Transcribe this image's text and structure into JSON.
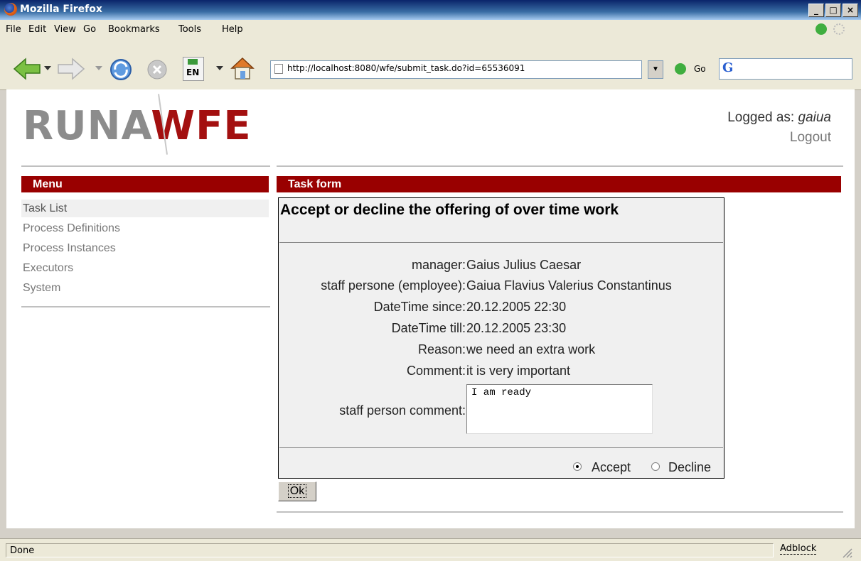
{
  "window": {
    "title": "Mozilla Firefox"
  },
  "menubar": [
    "File",
    "Edit",
    "View",
    "Go",
    "Bookmarks",
    "Tools",
    "Help"
  ],
  "toolbar": {
    "url": "http://localhost:8080/wfe/submit_task.do?id=65536091",
    "go_label": "Go",
    "lang_label": "EN"
  },
  "header": {
    "logo_left": "RUNA",
    "logo_right": "WFE",
    "logged_prefix": "Logged as: ",
    "user": "gaiua",
    "logout": "Logout"
  },
  "menu": {
    "title": "Menu",
    "items": [
      "Task List",
      "Process Definitions",
      "Process Instances",
      "Executors",
      "System"
    ]
  },
  "task": {
    "section_title": "Task form",
    "form_title": "Accept or decline the offering of over time work",
    "fields": [
      {
        "label": "manager:",
        "value": "Gaius Julius Caesar"
      },
      {
        "label": "staff persone (employee):",
        "value": "Gaiua Flavius Valerius Constantinus"
      },
      {
        "label": "DateTime since:",
        "value": "20.12.2005 22:30"
      },
      {
        "label": "DateTime till:",
        "value": "20.12.2005 23:30"
      },
      {
        "label": "Reason:",
        "value": "we need an extra work"
      },
      {
        "label": "Comment:",
        "value": "it is very important"
      }
    ],
    "comment_label": "staff person comment:",
    "comment_value": "I am ready",
    "accept_label": "Accept",
    "decline_label": "Decline",
    "selected": "Accept",
    "ok_label": "Ok"
  },
  "status": {
    "text": "Done",
    "adblock": "Adblock"
  },
  "colors": {
    "brand_red": "#990000",
    "logo_gray": "#8c8c8c"
  }
}
